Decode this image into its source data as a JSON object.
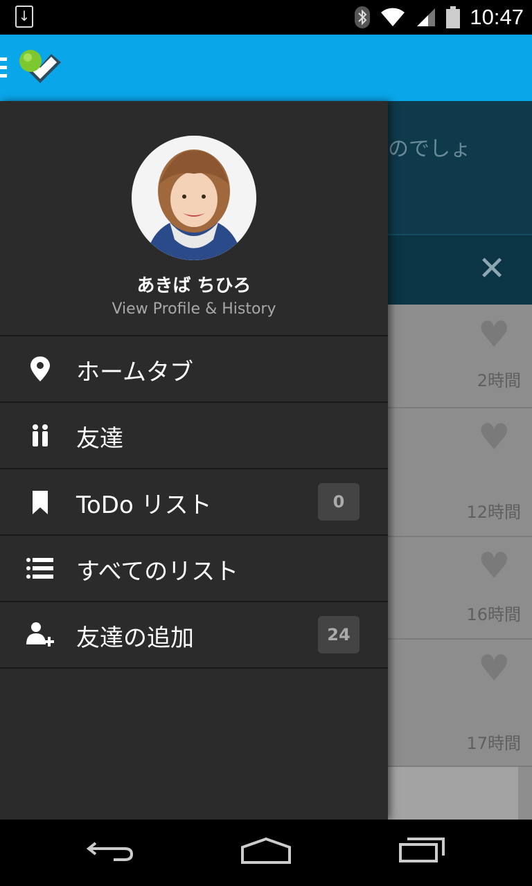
{
  "status_bar": {
    "time": "10:47"
  },
  "drawer": {
    "profile": {
      "name": "あきば ちひろ",
      "link": "View Profile & History"
    },
    "menu": [
      {
        "label": "ホームタブ",
        "icon": "location-pin-icon"
      },
      {
        "label": "友達",
        "icon": "friends-icon"
      },
      {
        "label": "ToDo リスト",
        "icon": "bookmark-icon",
        "badge": "0"
      },
      {
        "label": "すべてのリスト",
        "icon": "list-icon"
      },
      {
        "label": "友達の追加",
        "icon": "add-friend-icon",
        "badge": "24"
      }
    ]
  },
  "background": {
    "banner_text": "のでしょ",
    "rows": [
      {
        "time_ago": "2時間"
      },
      {
        "time_ago": "12時間"
      },
      {
        "time_ago": "16時間"
      },
      {
        "time_ago": "17時間"
      }
    ]
  },
  "colors": {
    "action_bar": "#0aa6ea",
    "drawer_bg": "#2b2b2b",
    "banner_bg": "#0f3a4b"
  }
}
